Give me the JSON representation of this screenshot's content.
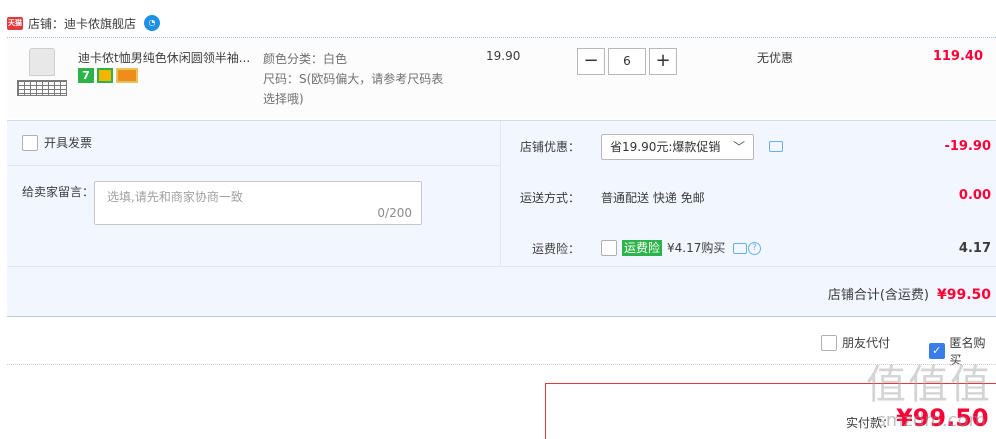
{
  "shop": {
    "badge": "天猫",
    "name": "店铺：迪卡侬旗舰店"
  },
  "item": {
    "title": "迪卡侬t恤男纯色休闲圆领半袖...",
    "icon7": "7",
    "sku_color": "颜色分类：白色",
    "sku_size": "尺码：S(欧码偏大，请参考尺码表选择哦)",
    "price": "19.90",
    "qty_minus": "−",
    "qty_value": "6",
    "qty_plus": "+",
    "promo": "无优惠",
    "total": "119.40"
  },
  "invoice": {
    "label": "开具发票"
  },
  "message": {
    "label": "给卖家留言：",
    "placeholder": "选填,请先和商家协商一致",
    "count": "0/200"
  },
  "discount": {
    "label": "店铺优惠：",
    "selected": "省19.90元:爆款促销",
    "arrow": "﹀",
    "amount": "-19.90"
  },
  "shipping": {
    "label": "运送方式：",
    "value": "普通配送 快递 免邮",
    "amount": "0.00"
  },
  "insurance": {
    "label": "运费险：",
    "badge": "运费险",
    "value": "¥4.17购买",
    "amount": "4.17"
  },
  "shop_total": {
    "label": "店铺合计(含运费)",
    "amount": "¥99.50"
  },
  "options": {
    "friend_pay": "朋友代付",
    "anonymous": "匿名购买"
  },
  "pay": {
    "label": "实付款：",
    "amount": "¥99.50"
  },
  "watermark": {
    "text": "值值值",
    "url": "smzdm.com"
  }
}
